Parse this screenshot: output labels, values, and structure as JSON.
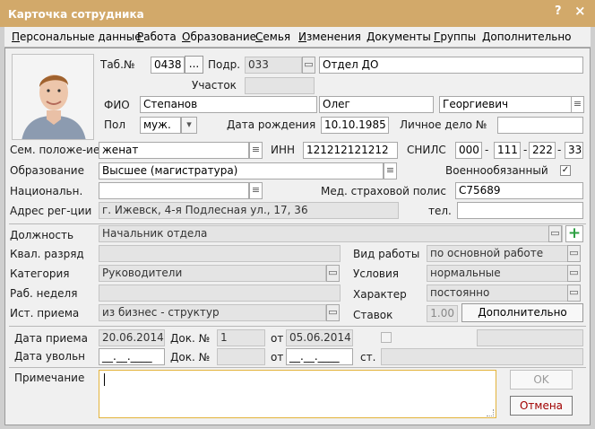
{
  "window": {
    "title": "Карточка сотрудника",
    "help_button": "?",
    "close_button": "×"
  },
  "menu": [
    "Персональные данные",
    "Работа",
    "Образование",
    "Семья",
    "Изменения",
    "Документы",
    "Группы",
    "Дополнительно"
  ],
  "header": {
    "tab_no_label": "Таб.№",
    "tab_no": "0438",
    "tab_btn": "...",
    "dept_label": "Подр.",
    "dept_code": "033",
    "dept_name": "Отдел ДО",
    "section_label": "Участок",
    "section": "",
    "fio_label": "ФИО",
    "last_name": "Степанов",
    "first_name": "Олег",
    "middle_name": "Георгиевич",
    "gender_label": "Пол",
    "gender": "муж.",
    "birth_label": "Дата рождения",
    "birth_date": "10.10.1985",
    "file_label": "Личное дело №",
    "file_no": ""
  },
  "personal": {
    "marital_label": "Сем. положе-ие",
    "marital": "женат",
    "inn_label": "ИНН",
    "inn": "121212121212",
    "snils_label": "СНИЛС",
    "snils": [
      "000",
      "111",
      "222",
      "33"
    ],
    "dash": "-",
    "edu_label": "Образование",
    "education": "Высшее (магистратура)",
    "military_label": "Военнообязанный",
    "military_checked": true,
    "check_mark": "✓",
    "nation_label": "Национальн.",
    "nationality": "",
    "insurance_label": "Мед. страховой полис",
    "insurance": "С75689",
    "address_label": "Адрес рег-ции",
    "address": "г. Ижевск, 4-я Подлесная ул., 17, 36",
    "phone_label": "тел.",
    "phone": ""
  },
  "job": {
    "position_label": "Должность",
    "position": "Начальник отдела",
    "grade_label": "Квал. разряд",
    "grade": "",
    "worktype_label": "Вид работы",
    "worktype": "по основной работе",
    "category_label": "Категория",
    "category": "Руководители",
    "conditions_label": "Условия",
    "conditions": "нормальные",
    "week_label": "Раб. неделя",
    "week": "",
    "nature_label": "Характер",
    "nature": "постоянно",
    "source_label": "Ист. приема",
    "source": "из бизнес - структур",
    "rates_label": "Ставок",
    "rates": "1.00",
    "extra_btn": "Дополнительно"
  },
  "dates": {
    "hire_label": "Дата приема",
    "hire_date": "20.06.2014",
    "doc_label": "Док. №",
    "hire_doc": "1",
    "from_label": "от",
    "hire_doc_date": "05.06.2014",
    "fire_label": "Дата увольн",
    "fire_date": "__.__.____",
    "fire_doc": "",
    "fire_doc_date": "__.__.____",
    "article_label": "ст.",
    "article": ""
  },
  "note": {
    "label": "Примечание",
    "text": ""
  },
  "buttons": {
    "ok": "OK",
    "cancel": "Отмена"
  }
}
